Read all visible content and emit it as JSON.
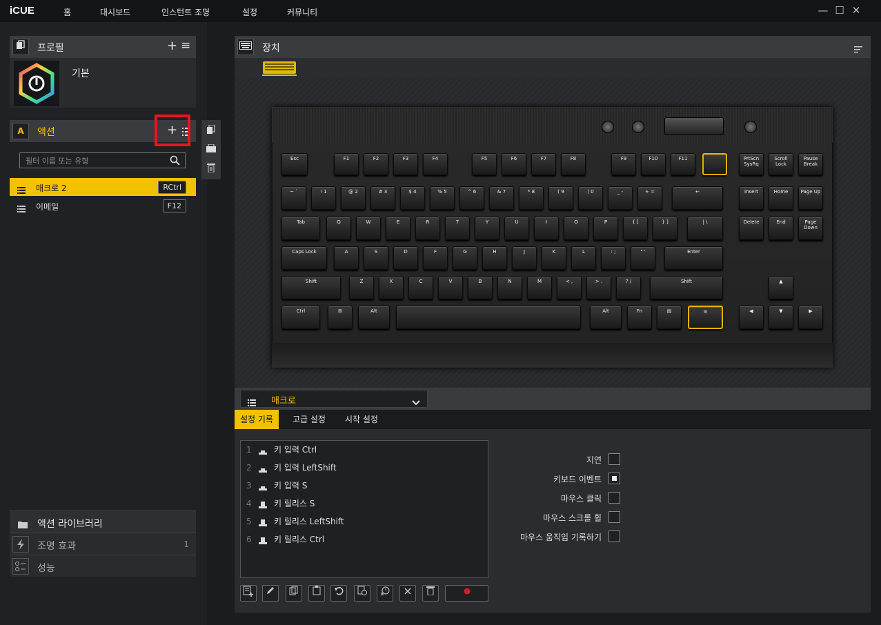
{
  "app": {
    "logo": "iCUE"
  },
  "nav": {
    "items": [
      "홈",
      "대시보드",
      "인스턴트 조명",
      "설정",
      "커뮤니티"
    ]
  },
  "window_controls": {
    "minimize": "—",
    "maximize": "☐",
    "close": "✕"
  },
  "profile_panel": {
    "title": "프로필",
    "add": "+",
    "menu": "≡",
    "profile_name": "기본"
  },
  "actions_panel": {
    "title": "액션",
    "icon_letter": "A",
    "add": "+",
    "filter_placeholder": "필터 이름 또는 유형",
    "items": [
      {
        "label": "매크로 2",
        "key": "RCtrl",
        "selected": true
      },
      {
        "label": "이메일",
        "key": "F12",
        "selected": false
      }
    ]
  },
  "bottom_sections": {
    "library": "액션 라이브러리",
    "lighting": "조명 효과",
    "lighting_count": "1",
    "performance": "성능"
  },
  "device_panel": {
    "title": "장치"
  },
  "keyboard": {
    "row_f": [
      "Esc",
      "F1",
      "F2",
      "F3",
      "F4",
      "F5",
      "F6",
      "F7",
      "F8",
      "F9",
      "F10",
      "F11",
      "",
      "PrtScn SysRq",
      "Scroll Lock",
      "Pause Break"
    ],
    "row_num": [
      "~ `",
      "! 1",
      "@ 2",
      "# 3",
      "$ 4",
      "% 5",
      "^ 6",
      "& 7",
      "* 8",
      "( 9",
      ") 0",
      "_ -",
      "+ =",
      "←",
      "Insert",
      "Home",
      "Page Up"
    ],
    "row_q": [
      "Tab",
      "Q",
      "W",
      "E",
      "R",
      "T",
      "Y",
      "U",
      "I",
      "O",
      "P",
      "{ [",
      "} ]",
      "| \\",
      "Delete",
      "End",
      "Page Down"
    ],
    "row_a": [
      "Caps Lock",
      "A",
      "S",
      "D",
      "F",
      "G",
      "H",
      "J",
      "K",
      "L",
      ": ;",
      "\" '",
      "Enter"
    ],
    "row_z": [
      "Shift",
      "Z",
      "X",
      "C",
      "V",
      "B",
      "N",
      "M",
      "< ,",
      "> .",
      "? /",
      "Shift"
    ],
    "row_ctrl": [
      "Ctrl",
      "⊞",
      "Alt",
      "",
      "Alt",
      "Fn",
      "▤",
      "≡"
    ],
    "arrows": [
      "▲",
      "◀",
      "▼",
      "▶"
    ]
  },
  "macro": {
    "selector": "매크로",
    "tabs": [
      "설정 기록",
      "고급 설정",
      "시작 설정"
    ],
    "active_tab": "설정 기록",
    "records": [
      {
        "n": "1",
        "text": "키 입력 Ctrl"
      },
      {
        "n": "2",
        "text": "키 입력 LeftShift"
      },
      {
        "n": "3",
        "text": "키 입력 S"
      },
      {
        "n": "4",
        "text": "키 릴리스 S"
      },
      {
        "n": "5",
        "text": "키 릴리스 LeftShift"
      },
      {
        "n": "6",
        "text": "키 릴리스 Ctrl"
      }
    ],
    "options": [
      {
        "label": "지연",
        "checked": false
      },
      {
        "label": "키보드 이벤트",
        "checked": true
      },
      {
        "label": "마우스 클릭",
        "checked": false
      },
      {
        "label": "마우스 스크롤 휠",
        "checked": false
      },
      {
        "label": "마우스 움직임 기록하기",
        "checked": false
      }
    ]
  },
  "colors": {
    "accent": "#f2c200",
    "highlight_box": "#e6161c",
    "record": "#d0202a"
  }
}
